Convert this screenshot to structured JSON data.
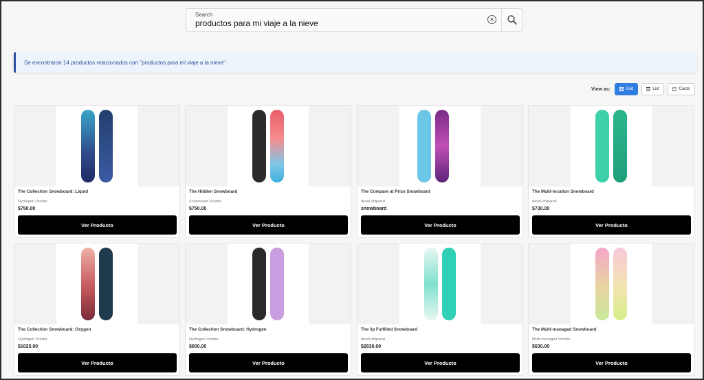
{
  "search": {
    "label": "Search",
    "value": "productos para mi viaje a la nieve",
    "clear_icon": "clear-icon",
    "submit_icon": "search-icon"
  },
  "banner": {
    "message": "Se encontraron 14 productos relacionados con \"productos para mi viaje a la nieve\""
  },
  "view": {
    "label": "View as:",
    "options": [
      {
        "label": "Grid",
        "icon": "grid-icon",
        "active": true
      },
      {
        "label": "List",
        "icon": "list-icon",
        "active": false
      },
      {
        "label": "Cards",
        "icon": "cards-icon",
        "active": false
      }
    ]
  },
  "colors": {
    "accent": "#2f7de1",
    "banner_text": "#2d4f9e",
    "button_bg": "#000000"
  },
  "products": [
    {
      "name": "The Collection Snowboard: Liquid",
      "vendor": "Hydrogen Vendor",
      "price": "$750.00",
      "button": "Ver Producto"
    },
    {
      "name": "The Hidden Snowboard",
      "vendor": "Snowboard Vendor",
      "price": "$750.00",
      "button": "Ver Producto"
    },
    {
      "name": "The Compare at Price Snowboard",
      "vendor": "devel-shipenal",
      "price": "snowboard",
      "button": "Ver Producto"
    },
    {
      "name": "The Multi-location Snowboard",
      "vendor": "devel-shipenal",
      "price": "$730.00",
      "button": "Ver Producto"
    },
    {
      "name": "The Collection Snowboard: Oxygen",
      "vendor": "Hydrogen Vendor",
      "price": "$1025.00",
      "button": "Ver Producto"
    },
    {
      "name": "The Collection Snowboard: Hydrogen",
      "vendor": "Hydrogen Vendor",
      "price": "$600.00",
      "button": "Ver Producto"
    },
    {
      "name": "The 3p Fulfilled Snowboard",
      "vendor": "devel-shipenal",
      "price": "$2630.00",
      "button": "Ver Producto"
    },
    {
      "name": "The Multi-managed Snowboard",
      "vendor": "Multi-managed Vendor",
      "price": "$630.00",
      "button": "Ver Producto"
    }
  ]
}
